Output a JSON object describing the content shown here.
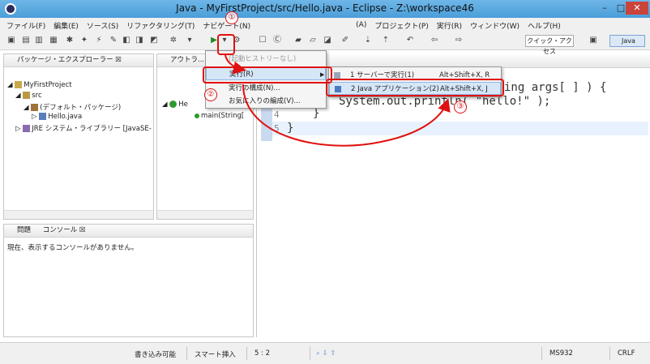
{
  "window": {
    "title": "Java - MyFirstProject/src/Hello.java - Eclipse - Z:\\workspace46",
    "min": "–",
    "max": "□",
    "close": "✕"
  },
  "menu": [
    "ファイル(F)",
    "編集(E)",
    "ソース(S)",
    "リファクタリング(T)",
    "ナビゲート(N)",
    "(A)",
    "プロジェクト(P)",
    "実行(R)",
    "ウィンドウ(W)",
    "ヘルプ(H)"
  ],
  "toolbar": {
    "quick_access": "クイック・アクセス",
    "perspective": "Java"
  },
  "package_explorer": {
    "title": "パッケージ・エクスプローラー ☒",
    "items": [
      "MyFirstProject",
      "src",
      "(デフォルト・パッケージ)",
      "Hello.java",
      "JRE システム・ライブラリー [JavaSE-"
    ]
  },
  "outline": {
    "title": "アウトラ...",
    "class_item": "He",
    "method_item": "main(String["
  },
  "console": {
    "title": "問題",
    "tab": "コンソール ☒",
    "message": "現在、表示するコンソールがありません。"
  },
  "dropdown": {
    "items": [
      {
        "label": "(起動ヒストリーなし)",
        "state": "disabled"
      },
      {
        "label": "実行(R)",
        "state": "selected",
        "arrow": "▶"
      },
      {
        "label": "実行の構成(N)...",
        "state": "normal"
      },
      {
        "label": "お気に入りの編成(V)...",
        "state": "normal"
      }
    ]
  },
  "submenu": {
    "items": [
      {
        "label": "1 サーバーで実行(1)",
        "shortcut": "Alt+Shift+X, R"
      },
      {
        "label": "2 Java アプリケーション(2)",
        "shortcut": "Alt+Shift+X, J"
      }
    ]
  },
  "editor": {
    "lines": [
      {
        "no": "4",
        "text": "}"
      },
      {
        "no": "5",
        "text": "}"
      }
    ],
    "code_fragment_1": "ing args[ ] ) {",
    "code_fragment_2": "System.out.println( \"hello!\" );"
  },
  "annotations": [
    "①",
    "②",
    "③"
  ],
  "status": {
    "writable": "書き込み可能",
    "insert": "スマート挿入",
    "position": "5 : 2",
    "encoding": "MS932",
    "line_ending": "CRLF"
  },
  "colors": {
    "accent_red": "#e01010",
    "keyword": "#7f0055",
    "string": "#2a00ff"
  }
}
